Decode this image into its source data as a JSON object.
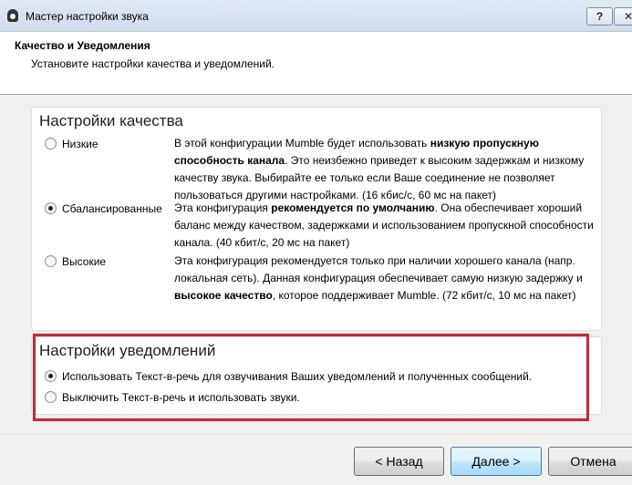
{
  "window": {
    "title": "Мастер настройки звука",
    "help_label": "?",
    "close_label": "✕"
  },
  "header": {
    "title": "Качество и Уведомления",
    "subtitle": "Установите настройки качества и уведомлений."
  },
  "quality": {
    "group_title": "Настройки качества",
    "options": [
      {
        "label": "Низкие",
        "checked": false,
        "desc_parts": [
          {
            "text": "В этой конфигурации Mumble будет использовать ",
            "bold": false
          },
          {
            "text": "низкую пропускную способность канала",
            "bold": true
          },
          {
            "text": ". Это неизбежно приведет к высоким задержкам и низкому качеству звука. Выбирайте ее только если Ваше соединение не позволяет пользоваться другими настройками. (16 кбис/с, 60 мс на пакет)",
            "bold": false
          }
        ]
      },
      {
        "label": "Сбалансированные",
        "checked": true,
        "desc_parts": [
          {
            "text": "Эта конфигурация ",
            "bold": false
          },
          {
            "text": "рекомендуется по умолчанию",
            "bold": true
          },
          {
            "text": ". Она обеспечивает хороший баланс между качеством, задержками и использованием пропускной способности канала. (40 кбит/с, 20 мс на пакет)",
            "bold": false
          }
        ]
      },
      {
        "label": "Высокие",
        "checked": false,
        "desc_parts": [
          {
            "text": "Эта конфигурация рекомендуется только при наличии хорошего канала (напр. локальная сеть). Данная конфигурация обеспечивает самую низкую задержку и ",
            "bold": false
          },
          {
            "text": "высокое качество",
            "bold": true
          },
          {
            "text": ", которое поддерживает Mumble. (72 кбит/с, 10 мс на пакет)",
            "bold": false
          }
        ]
      }
    ]
  },
  "notifications": {
    "group_title": "Настройки уведомлений",
    "options": [
      {
        "label": "Использовать Текст-в-речь для озвучивания Ваших уведомлений и полученных сообщений.",
        "checked": true
      },
      {
        "label": "Выключить Текст-в-речь и использовать звуки.",
        "checked": false
      }
    ]
  },
  "buttons": {
    "back": "< Назад",
    "next": "Далее >",
    "cancel": "Отмена"
  },
  "colors": {
    "highlight_border": "#d7232d",
    "default_button_border": "#3c7fb1"
  }
}
